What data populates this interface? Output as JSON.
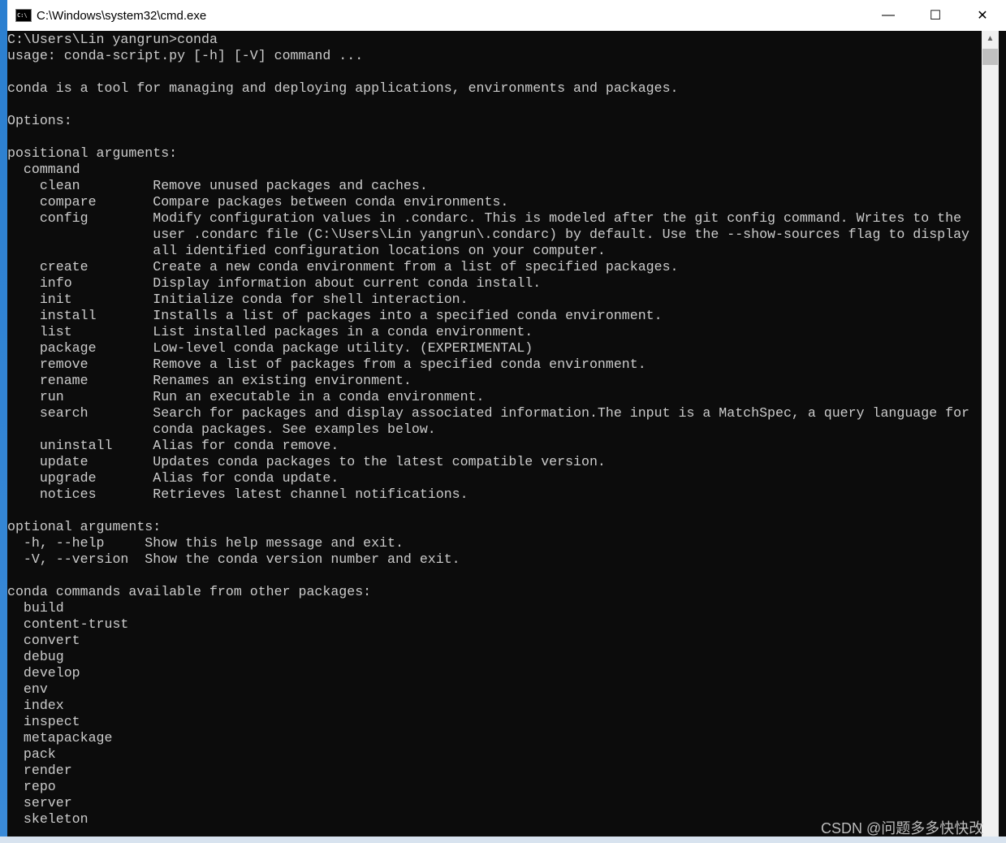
{
  "window": {
    "title": "C:\\Windows\\system32\\cmd.exe",
    "minimize": "—",
    "maximize": "☐",
    "close": "✕"
  },
  "console": {
    "lines": [
      "C:\\Users\\Lin yangrun>conda",
      "usage: conda-script.py [-h] [-V] command ...",
      "",
      "conda is a tool for managing and deploying applications, environments and packages.",
      "",
      "Options:",
      "",
      "positional arguments:",
      "  command",
      "    clean         Remove unused packages and caches.",
      "    compare       Compare packages between conda environments.",
      "    config        Modify configuration values in .condarc. This is modeled after the git config command. Writes to the",
      "                  user .condarc file (C:\\Users\\Lin yangrun\\.condarc) by default. Use the --show-sources flag to display",
      "                  all identified configuration locations on your computer.",
      "    create        Create a new conda environment from a list of specified packages.",
      "    info          Display information about current conda install.",
      "    init          Initialize conda for shell interaction.",
      "    install       Installs a list of packages into a specified conda environment.",
      "    list          List installed packages in a conda environment.",
      "    package       Low-level conda package utility. (EXPERIMENTAL)",
      "    remove        Remove a list of packages from a specified conda environment.",
      "    rename        Renames an existing environment.",
      "    run           Run an executable in a conda environment.",
      "    search        Search for packages and display associated information.The input is a MatchSpec, a query language for",
      "                  conda packages. See examples below.",
      "    uninstall     Alias for conda remove.",
      "    update        Updates conda packages to the latest compatible version.",
      "    upgrade       Alias for conda update.",
      "    notices       Retrieves latest channel notifications.",
      "",
      "optional arguments:",
      "  -h, --help     Show this help message and exit.",
      "  -V, --version  Show the conda version number and exit.",
      "",
      "conda commands available from other packages:",
      "  build",
      "  content-trust",
      "  convert",
      "  debug",
      "  develop",
      "  env",
      "  index",
      "  inspect",
      "  metapackage",
      "  pack",
      "  render",
      "  repo",
      "  server",
      "  skeleton"
    ]
  },
  "watermark": "CSDN @问题多多快快改"
}
